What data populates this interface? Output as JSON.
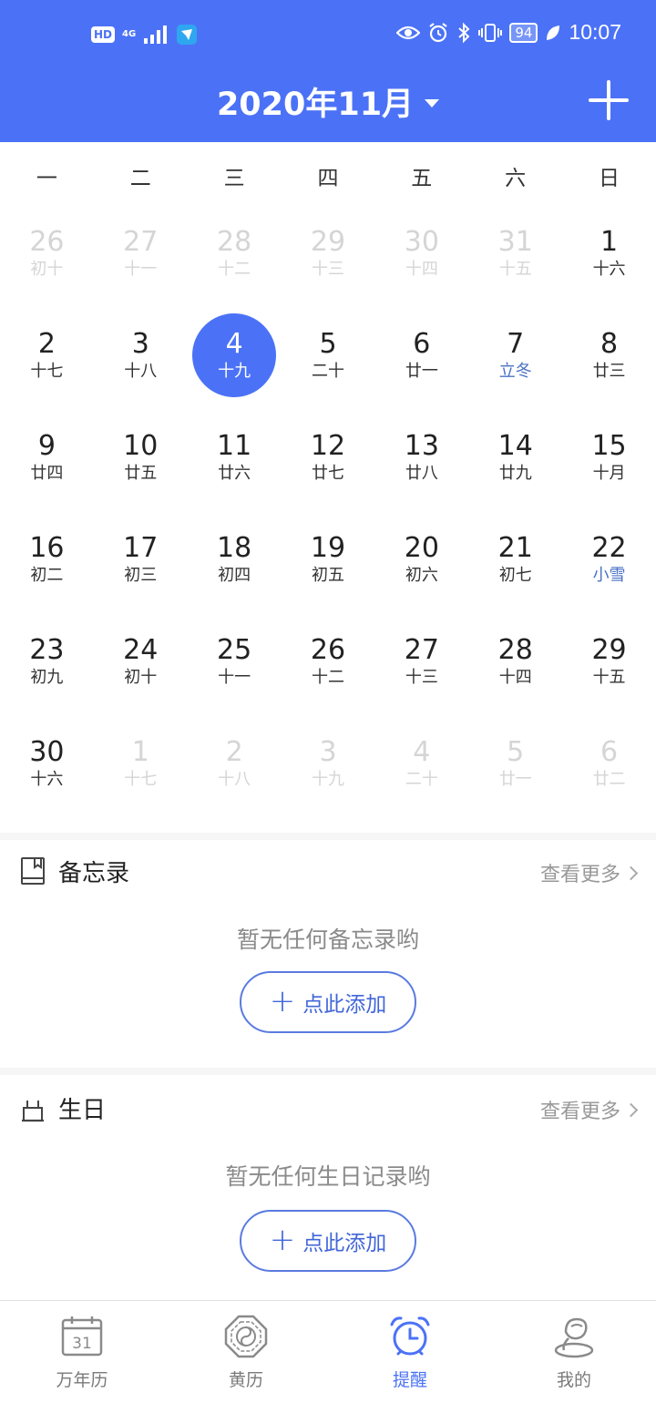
{
  "status_bar": {
    "hd": "HD",
    "network": "4G",
    "battery": "94",
    "time": "10:07"
  },
  "header": {
    "month_title": "2020年11月",
    "add_icon": "plus-icon"
  },
  "weekdays": [
    "一",
    "二",
    "三",
    "四",
    "五",
    "六",
    "日"
  ],
  "calendar": {
    "days": [
      {
        "d": "26",
        "l": "初十",
        "other": true
      },
      {
        "d": "27",
        "l": "十一",
        "other": true
      },
      {
        "d": "28",
        "l": "十二",
        "other": true
      },
      {
        "d": "29",
        "l": "十三",
        "other": true
      },
      {
        "d": "30",
        "l": "十四",
        "other": true
      },
      {
        "d": "31",
        "l": "十五",
        "other": true
      },
      {
        "d": "1",
        "l": "十六"
      },
      {
        "d": "2",
        "l": "十七"
      },
      {
        "d": "3",
        "l": "十八"
      },
      {
        "d": "4",
        "l": "十九",
        "today": true
      },
      {
        "d": "5",
        "l": "二十"
      },
      {
        "d": "6",
        "l": "廿一"
      },
      {
        "d": "7",
        "l": "立冬",
        "term": true
      },
      {
        "d": "8",
        "l": "廿三"
      },
      {
        "d": "9",
        "l": "廿四"
      },
      {
        "d": "10",
        "l": "廿五"
      },
      {
        "d": "11",
        "l": "廿六"
      },
      {
        "d": "12",
        "l": "廿七"
      },
      {
        "d": "13",
        "l": "廿八"
      },
      {
        "d": "14",
        "l": "廿九"
      },
      {
        "d": "15",
        "l": "十月"
      },
      {
        "d": "16",
        "l": "初二"
      },
      {
        "d": "17",
        "l": "初三"
      },
      {
        "d": "18",
        "l": "初四"
      },
      {
        "d": "19",
        "l": "初五"
      },
      {
        "d": "20",
        "l": "初六"
      },
      {
        "d": "21",
        "l": "初七"
      },
      {
        "d": "22",
        "l": "小雪",
        "term": true
      },
      {
        "d": "23",
        "l": "初九"
      },
      {
        "d": "24",
        "l": "初十"
      },
      {
        "d": "25",
        "l": "十一"
      },
      {
        "d": "26",
        "l": "十二"
      },
      {
        "d": "27",
        "l": "十三"
      },
      {
        "d": "28",
        "l": "十四"
      },
      {
        "d": "29",
        "l": "十五"
      },
      {
        "d": "30",
        "l": "十六"
      },
      {
        "d": "1",
        "l": "十七",
        "other": true
      },
      {
        "d": "2",
        "l": "十八",
        "other": true
      },
      {
        "d": "3",
        "l": "十九",
        "other": true
      },
      {
        "d": "4",
        "l": "二十",
        "other": true
      },
      {
        "d": "5",
        "l": "廿一",
        "other": true
      },
      {
        "d": "6",
        "l": "廿二",
        "other": true
      }
    ],
    "colors": {
      "accent": "#4b72f6",
      "solar_term": "#4b72c4",
      "other_month": "#d5d5d5"
    }
  },
  "memo": {
    "title": "备忘录",
    "more": "查看更多",
    "empty": "暂无任何备忘录哟",
    "add": "点此添加",
    "icon": "book-icon"
  },
  "birthday": {
    "title": "生日",
    "more": "查看更多",
    "empty": "暂无任何生日记录哟",
    "add": "点此添加",
    "icon": "cake-icon"
  },
  "nav": {
    "items": [
      {
        "label": "万年历",
        "icon": "calendar-icon",
        "badge": "31"
      },
      {
        "label": "黄历",
        "icon": "bagua-icon"
      },
      {
        "label": "提醒",
        "icon": "alarm-clock-icon",
        "active": true
      },
      {
        "label": "我的",
        "icon": "profile-icon"
      }
    ]
  }
}
